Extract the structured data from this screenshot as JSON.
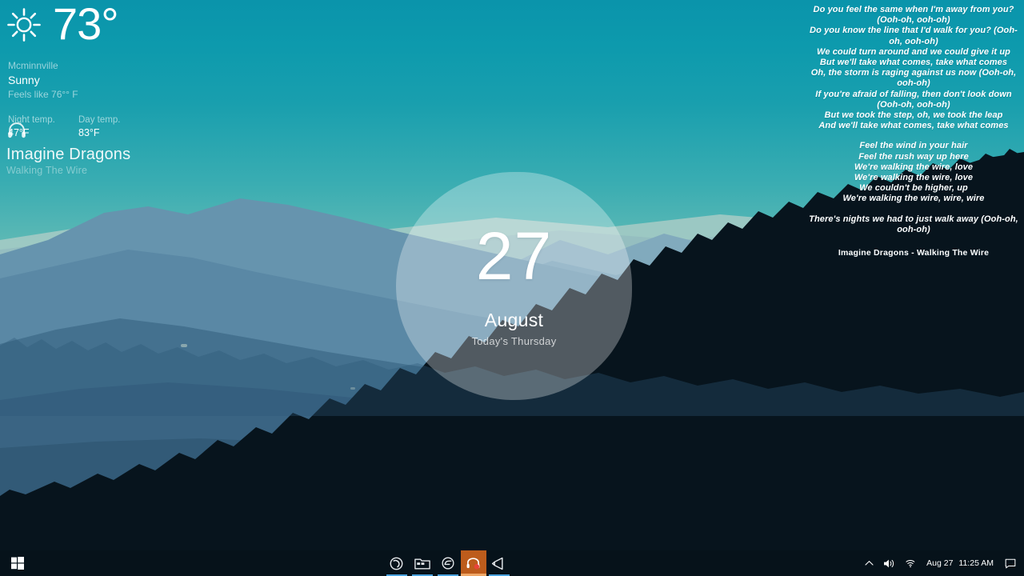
{
  "wallpaper": {
    "description": "layered blue mountain ridges with forest silhouette under teal gradient sky",
    "sky_top_color": "#0a94ab",
    "sky_bottom_color": "#c6dcc6",
    "ridge_colors": [
      "#9fc6c6",
      "#88b4bf",
      "#6f9fb5",
      "#5e8fab",
      "#4a7c9c",
      "#3a6a8c",
      "#2d5878",
      "#1e4460",
      "#12303f",
      "#0a1d28",
      "#05111a"
    ]
  },
  "weather": {
    "icon": "sun-icon",
    "temperature": "73°",
    "city": "Mcminnville",
    "condition": "Sunny",
    "feels_like": "Feels like 76°° F",
    "night": {
      "label": "Night temp.",
      "value": "47°F"
    },
    "day": {
      "label": "Day temp.",
      "value": "83°F"
    }
  },
  "music": {
    "icon": "headphones-icon",
    "artist": "Imagine Dragons",
    "track": "Walking The Wire"
  },
  "date_widget": {
    "day": "27",
    "month": "August",
    "weekday": "Today's Thursday"
  },
  "lyrics": {
    "lines": [
      "Do you feel the same when I'm away from you? (Ooh-oh, ooh-oh)",
      "Do you know the line that I'd walk for you? (Ooh-oh, ooh-oh)",
      "We could turn around and we could give it up",
      "But we'll take what comes, take what comes",
      "Oh, the storm is raging against us now (Ooh-oh, ooh-oh)",
      "If you're afraid of falling, then don't look down (Ooh-oh, ooh-oh)",
      "But we took the step, oh, we took the leap",
      "And we'll take what comes, take what comes"
    ],
    "lines_group2": [
      "Feel the wind in your hair",
      "Feel the rush way up here",
      "We're walking the wire, love",
      "We're walking the wire, love",
      "We couldn't be higher, up",
      "We're walking the wire, wire, wire"
    ],
    "lines_group3": [
      "There's nights we had to just walk away (Ooh-oh, ooh-oh)"
    ],
    "now_playing": "Imagine Dragons - Walking The Wire"
  },
  "taskbar": {
    "start_label": "Start",
    "apps": [
      {
        "name": "cortana-icon",
        "label": "Cortana",
        "active": false
      },
      {
        "name": "file-explorer-icon",
        "label": "File Explorer",
        "active": false
      },
      {
        "name": "browser-icon",
        "label": "Browser",
        "active": false
      },
      {
        "name": "media-app-icon",
        "label": "Media App",
        "active": true
      },
      {
        "name": "code-editor-icon",
        "label": "Code Editor",
        "active": false
      }
    ],
    "tray": {
      "show_hidden_label": "Show hidden icons",
      "volume_label": "Volume",
      "network_label": "Network",
      "date": "Aug 27",
      "time": "11:25 AM",
      "action_center_label": "Action Center"
    },
    "accent_color": "#4aa3df",
    "active_app_color": "#bd5c1c"
  }
}
